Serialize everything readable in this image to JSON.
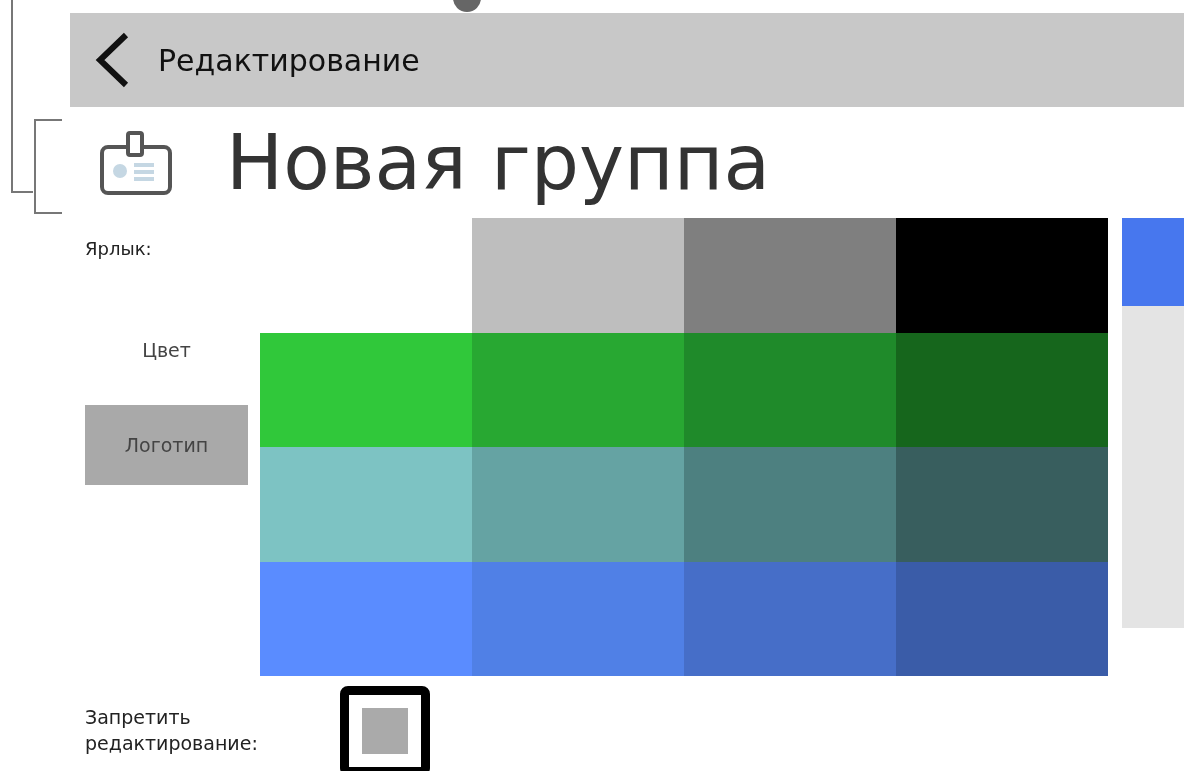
{
  "header": {
    "title": "Редактирование"
  },
  "group": {
    "title": "Новая группа"
  },
  "label_caption": "Ярлык:",
  "tabs": [
    {
      "label": "Цвет",
      "selected": false
    },
    {
      "label": "Логотип",
      "selected": true
    }
  ],
  "palette": [
    [
      {
        "color": "#bebebe"
      },
      {
        "color": "#7f7f7f"
      },
      {
        "color": "#000000"
      }
    ],
    [
      {
        "color": "#30c83a"
      },
      {
        "color": "#28a832"
      },
      {
        "color": "#1f8a2a"
      },
      {
        "color": "#16661c"
      }
    ],
    [
      {
        "color": "#7dc3c3"
      },
      {
        "color": "#65a3a3"
      },
      {
        "color": "#4d8080"
      },
      {
        "color": "#385e5e"
      }
    ],
    [
      {
        "color": "#5a8cff"
      },
      {
        "color": "#5080e6"
      },
      {
        "color": "#466ec8"
      },
      {
        "color": "#3a5ca8"
      }
    ]
  ],
  "preview": {
    "color": "#4777ee"
  },
  "lock": {
    "label": "Запретить\nредактирование:",
    "checked": false
  }
}
